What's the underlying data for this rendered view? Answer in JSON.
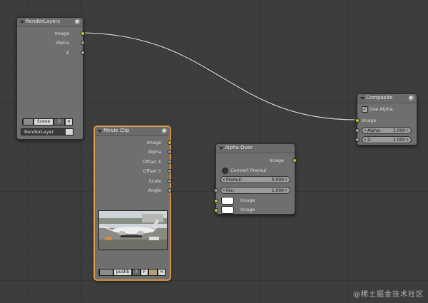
{
  "render_layers": {
    "title": "RenderLayers",
    "outputs": [
      "Image",
      "Alpha",
      "Z"
    ],
    "scene_value": "Scene",
    "scene_users": "2",
    "layer_value": "RenderLayer"
  },
  "movie_clip": {
    "title": "Movie Clip",
    "outputs": [
      "Image",
      "Alpha",
      "Offset X",
      "Offset Y",
      "Scale",
      "Angle"
    ],
    "clip_name": "pushb",
    "clip_users": "7",
    "fake_user": "F"
  },
  "alpha_over": {
    "title": "Alpha Over",
    "output": "Image",
    "convert_premul_label": "Convert Premul",
    "convert_premul_checked": false,
    "premul_label": "Premul:",
    "premul_value": "0.000",
    "fac_label": "Fac:",
    "fac_value": "1.000",
    "inputs": [
      "Image",
      "Image"
    ]
  },
  "composite": {
    "title": "Composite",
    "use_alpha_label": "Use Alpha",
    "use_alpha_checked": true,
    "inputs": [
      "Image"
    ],
    "alpha_label": "Alpha:",
    "alpha_value": "1.000",
    "z_label": "Z:",
    "z_value": "1.000"
  },
  "colors": {
    "link": "#c8c8c8",
    "image_socket": "#c7c729",
    "value_socket": "#a1a1a1",
    "active_border": "#e0a050"
  },
  "watermark": "@稀土掘金技术社区"
}
